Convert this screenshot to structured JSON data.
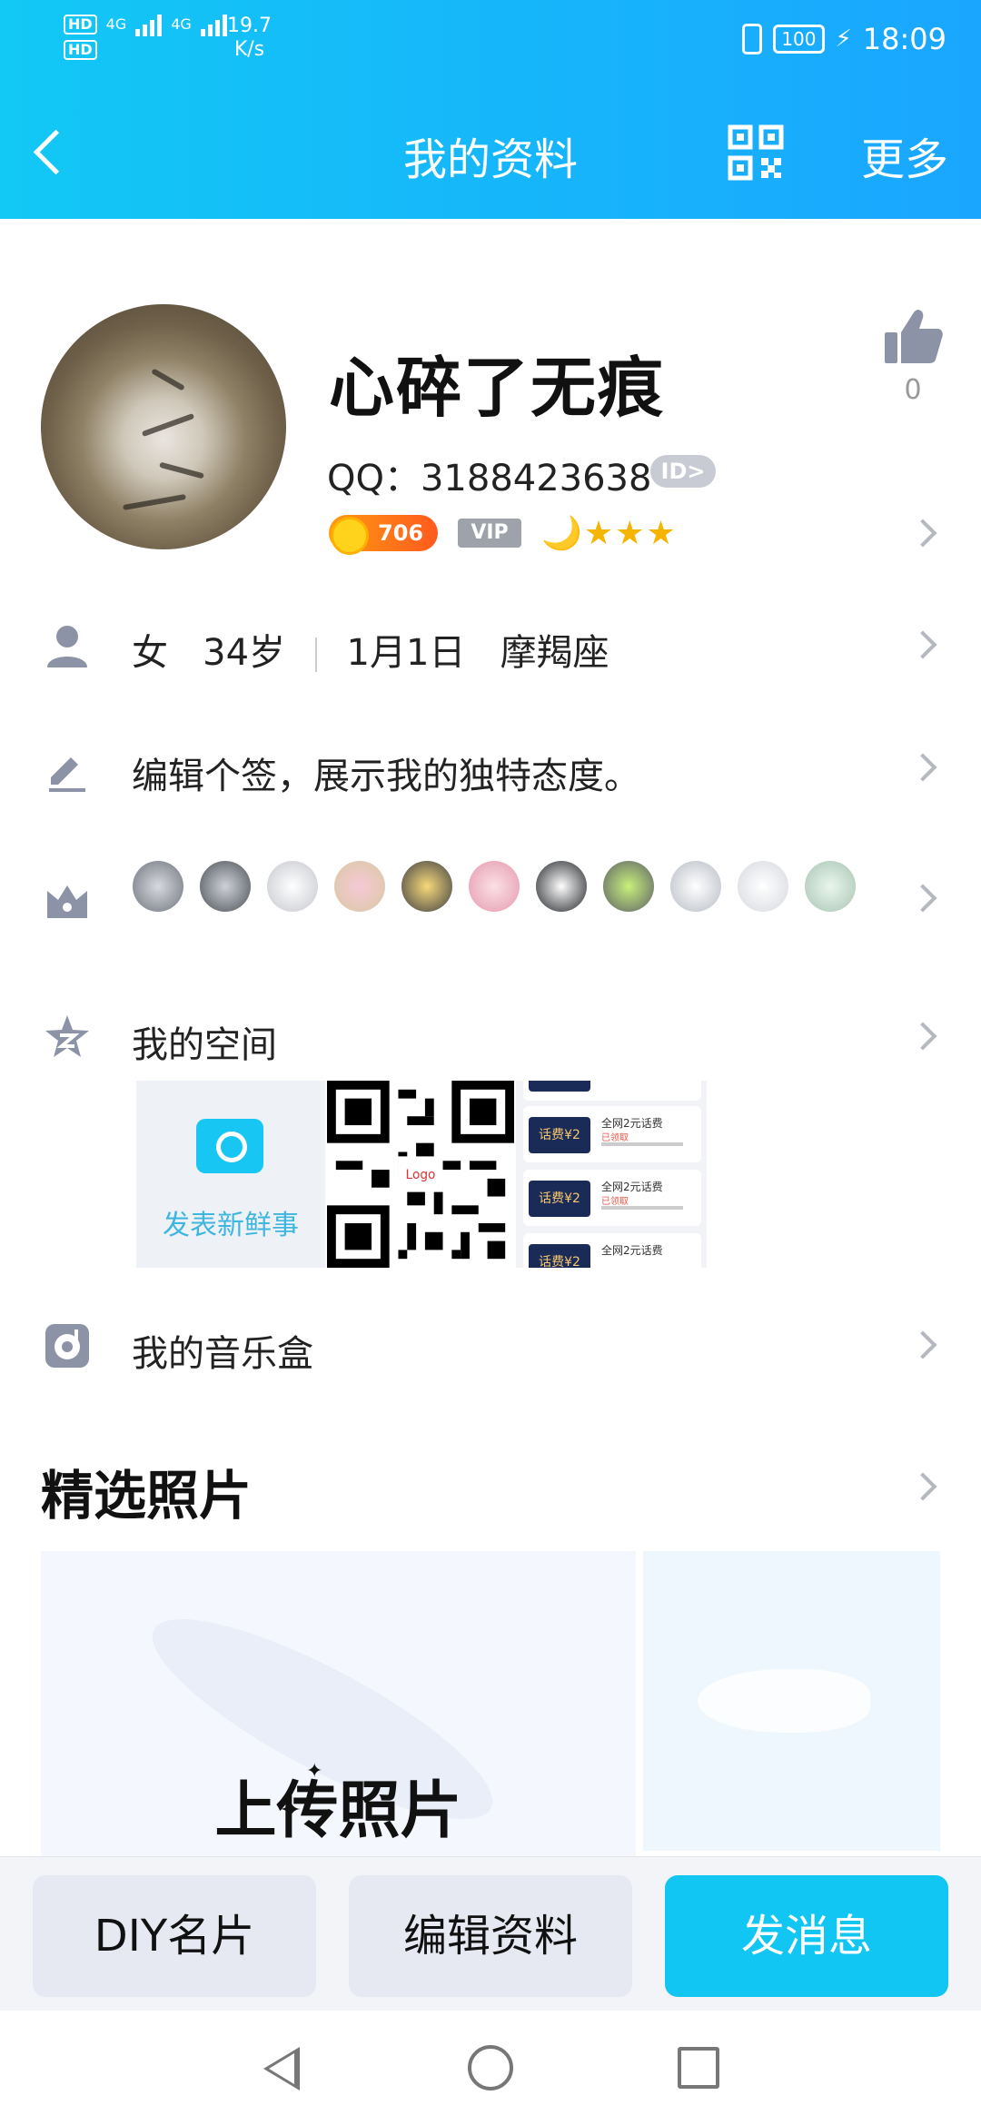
{
  "status_bar": {
    "hd1": "HD",
    "hd2": "HD",
    "net1": "4G",
    "net2": "4G",
    "speed_value": "19.7",
    "speed_unit": "K/s",
    "battery": "100",
    "time": "18:09"
  },
  "nav": {
    "title": "我的资料",
    "more": "更多"
  },
  "profile": {
    "nickname": "心碎了无痕",
    "like_count": "0",
    "qq_label": "QQ：3188423638",
    "id_badge": "ID>",
    "level": "706",
    "vip": "VIP",
    "rank_icons": "🌙★★★"
  },
  "info": {
    "gender": "女",
    "age": "34岁",
    "birthday": "1月1日",
    "zodiac": "摩羯座"
  },
  "signature": {
    "placeholder": "编辑个签，展示我的独特态度。"
  },
  "space": {
    "label": "我的空间",
    "post_new": "发表新鲜事",
    "coupon_ticket": "话费¥2",
    "coupon_title": "全网2元话费",
    "coupon_sub": "已领取"
  },
  "music": {
    "label": "我的音乐盒"
  },
  "photos": {
    "section_title": "精选照片",
    "upload_label": "上传照片"
  },
  "bottom_bar": {
    "diy": "DIY名片",
    "edit": "编辑资料",
    "message": "发消息"
  },
  "colors": {
    "header_start": "#12c8f5",
    "header_end": "#1aa6ff",
    "primary_button": "#12c6f3"
  }
}
